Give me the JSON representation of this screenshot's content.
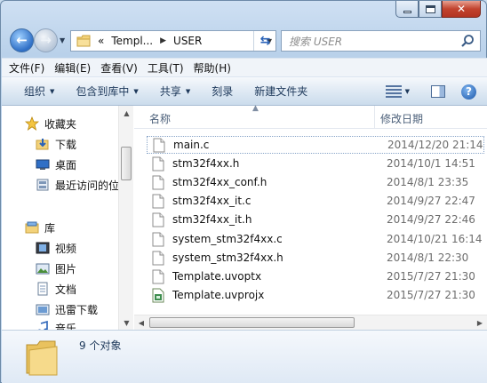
{
  "window": {
    "caption": {
      "minimize": "minimize",
      "maximize": "maximize",
      "close": "close"
    }
  },
  "nav": {
    "address_crumbs": [
      "«",
      "Templ...",
      "USER"
    ],
    "search_placeholder": "搜索 USER"
  },
  "menu": [
    "文件(F)",
    "编辑(E)",
    "查看(V)",
    "工具(T)",
    "帮助(H)"
  ],
  "commands": [
    {
      "label": "组织",
      "dropdown": true
    },
    {
      "label": "包含到库中",
      "dropdown": true
    },
    {
      "label": "共享",
      "dropdown": true
    },
    {
      "label": "刻录",
      "dropdown": false
    },
    {
      "label": "新建文件夹",
      "dropdown": false
    }
  ],
  "sidebar": {
    "favorites": {
      "label": "收藏夹",
      "icon": "star-icon"
    },
    "favorite_items": [
      {
        "label": "下载",
        "icon": "downloads-folder-icon"
      },
      {
        "label": "桌面",
        "icon": "desktop-icon"
      },
      {
        "label": "最近访问的位",
        "icon": "recent-places-icon"
      }
    ],
    "libraries": {
      "label": "库",
      "icon": "library-icon"
    },
    "library_items": [
      {
        "label": "视频",
        "icon": "video-library-icon"
      },
      {
        "label": "图片",
        "icon": "pictures-library-icon"
      },
      {
        "label": "文档",
        "icon": "documents-library-icon"
      },
      {
        "label": "迅雷下载",
        "icon": "thunder-download-icon"
      },
      {
        "label": "音乐",
        "icon": "music-library-icon"
      }
    ]
  },
  "files": {
    "columns": {
      "name": "名称",
      "date": "修改日期"
    },
    "rows": [
      {
        "name": "main.c",
        "date": "2014/12/20 21:14",
        "icon": "c-file-icon",
        "selected": true
      },
      {
        "name": "stm32f4xx.h",
        "date": "2014/10/1 14:51",
        "icon": "h-file-icon",
        "selected": false
      },
      {
        "name": "stm32f4xx_conf.h",
        "date": "2014/8/1 23:35",
        "icon": "h-file-icon",
        "selected": false
      },
      {
        "name": "stm32f4xx_it.c",
        "date": "2014/9/27 22:47",
        "icon": "c-file-icon",
        "selected": false
      },
      {
        "name": "stm32f4xx_it.h",
        "date": "2014/9/27 22:46",
        "icon": "h-file-icon",
        "selected": false
      },
      {
        "name": "system_stm32f4xx.c",
        "date": "2014/10/21 16:14",
        "icon": "c-file-icon",
        "selected": false
      },
      {
        "name": "system_stm32f4xx.h",
        "date": "2014/8/1 22:30",
        "icon": "h-file-icon",
        "selected": false
      },
      {
        "name": "Template.uvoptx",
        "date": "2015/7/27 21:30",
        "icon": "generic-file-icon",
        "selected": false
      },
      {
        "name": "Template.uvprojx",
        "date": "2015/7/27 21:30",
        "icon": "keil-project-icon",
        "selected": false
      }
    ]
  },
  "status": {
    "item_count": "9 个对象"
  }
}
